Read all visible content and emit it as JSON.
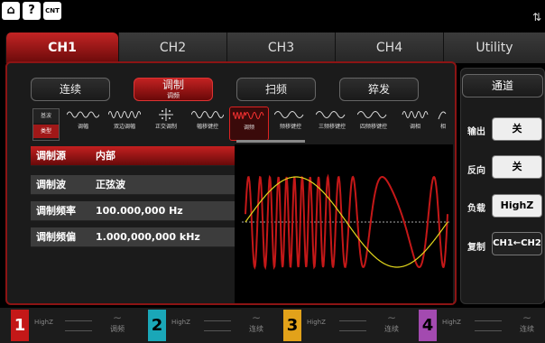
{
  "topbar": {
    "home_icon": "home-icon",
    "help_label": "?",
    "cnt_label": "CNT",
    "usb_icon": "usb-icon"
  },
  "tabs": [
    {
      "label": "CH1"
    },
    {
      "label": "CH2"
    },
    {
      "label": "CH3"
    },
    {
      "label": "CH4"
    },
    {
      "label": "Utility"
    }
  ],
  "modes": [
    {
      "label": "连续"
    },
    {
      "label": "调制",
      "sub": "调频"
    },
    {
      "label": "扫频"
    },
    {
      "label": "猝发"
    }
  ],
  "type_box": {
    "label_a": "基波",
    "label_b": "类型"
  },
  "mod_types": [
    {
      "label": "调幅"
    },
    {
      "label": "双边调幅"
    },
    {
      "label": "正交调制"
    },
    {
      "label": "幅移键控"
    },
    {
      "label": "调频"
    },
    {
      "label": "频移键控"
    },
    {
      "label": "三频移键控"
    },
    {
      "label": "四频移键控"
    },
    {
      "label": "调相"
    },
    {
      "label": "相"
    }
  ],
  "params": [
    {
      "key": "调制源",
      "value": "内部"
    },
    {
      "key": "调制波",
      "value": "正弦波"
    },
    {
      "key": "调制频率",
      "value": "100.000,000 Hz"
    },
    {
      "key": "调制频偏",
      "value": "1.000,000,000 kHz"
    }
  ],
  "right": {
    "header": "通道",
    "output_label": "输出",
    "output_value": "关",
    "invert_label": "反向",
    "invert_value": "关",
    "load_label": "负载",
    "load_value": "HighZ",
    "copy_label": "复制",
    "copy_value": "CH1←CH2"
  },
  "channels": [
    {
      "num": "1",
      "z": "HighZ",
      "mode": "调频",
      "color": "#c41818"
    },
    {
      "num": "2",
      "z": "HighZ",
      "mode": "连续",
      "color": "#1aa7b8"
    },
    {
      "num": "3",
      "z": "HighZ",
      "mode": "连续",
      "color": "#e2a21a"
    },
    {
      "num": "4",
      "z": "HighZ",
      "mode": "连续",
      "color": "#a34ab0"
    }
  ],
  "colors": {
    "accent": "#c41818",
    "carrier_wave": "#c41818",
    "mod_wave": "#e4d81c"
  }
}
